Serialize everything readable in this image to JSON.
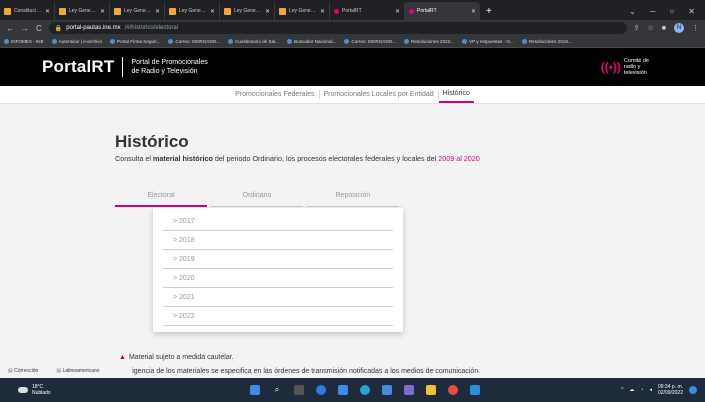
{
  "browser": {
    "tabs": [
      {
        "label": "Constitución Polít",
        "active": false,
        "favicon": "document-icon"
      },
      {
        "label": "Ley General de P",
        "active": false,
        "favicon": "document-icon"
      },
      {
        "label": "Ley General de P",
        "active": false,
        "favicon": "document-icon"
      },
      {
        "label": "Ley General de I",
        "active": false,
        "favicon": "document-icon"
      },
      {
        "label": "Ley General de I",
        "active": false,
        "favicon": "document-icon"
      },
      {
        "label": "Ley General de I",
        "active": false,
        "favicon": "document-icon"
      },
      {
        "label": "PortalRT",
        "active": false,
        "favicon": "portalrt-icon"
      },
      {
        "label": "PortalRT",
        "active": true,
        "favicon": "portalrt-icon"
      }
    ],
    "new_tab": "+",
    "url_host": "portal-pautas.ine.mx",
    "url_path": "/#/historico/electoral",
    "bookmarks": [
      "INFOMEX - INE",
      "Autenticar | e-archivo",
      "Portal Firma Seguri...",
      "Correo: MORGADO...",
      "Cuestionario de Sal...",
      "Buscador Nacional...",
      "Correo: MORGADO...",
      "Resoluciones 2022...",
      "VP y respuestas - O...",
      "Resoluciones 2019..."
    ],
    "profile_initial": "N"
  },
  "site": {
    "logo": "PortalRT",
    "logo_sub1": "Portal de Promocionales",
    "logo_sub2": "de Radio y Televisión",
    "comite1": "Comité de",
    "comite2": "radio y",
    "comite3": "televisión",
    "nav": [
      "Promocionales Federales",
      "Promocionales Locales por Entidad",
      "Histórico"
    ],
    "nav_active": "Histórico"
  },
  "page": {
    "title": "Histórico",
    "subtitle_pre": "Consulta el ",
    "subtitle_bold": "material histórico",
    "subtitle_mid": " del periodo Ordinario, los procesos electorales federales y locales del ",
    "subtitle_range": "2009 al 2020",
    "tabs": [
      "Electoral",
      "Ordinario",
      "Reposición"
    ],
    "active_tab": "Electoral",
    "years": [
      "> 2017",
      "> 2018",
      "> 2019",
      "> 2020",
      "> 2021",
      "> 2022"
    ],
    "warning": "Material sujeto a medida cautelar.",
    "note": "La vigencia de los materiales se especifica en las órdenes de transmisión notificadas a los medios de comunicación."
  },
  "downloads": [
    "Corrección",
    "Latinoamericano"
  ],
  "taskbar": {
    "temp": "18°C",
    "weather": "Nublado",
    "time": "09:34 p. m.",
    "date": "02/09/2022"
  },
  "colors": {
    "accent": "#d5007f",
    "header_bg": "#000000",
    "taskbar_bg": "#1e2b3a"
  }
}
